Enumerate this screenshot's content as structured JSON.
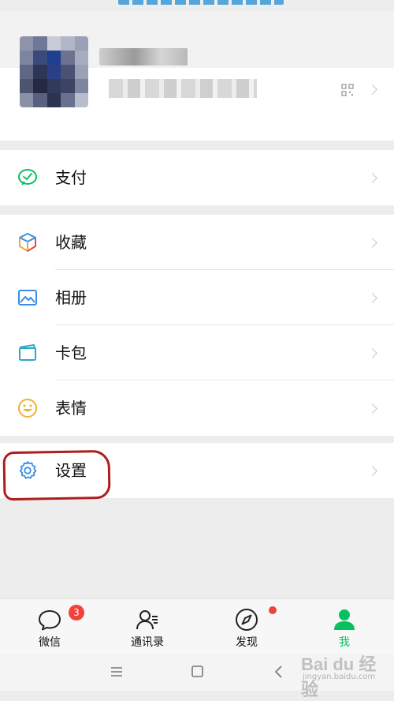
{
  "menu": {
    "pay": {
      "label": "支付",
      "icon": "wechat-pay-icon"
    },
    "favorites": {
      "label": "收藏",
      "icon": "favorites-cube-icon"
    },
    "album": {
      "label": "相册",
      "icon": "album-image-icon"
    },
    "cards": {
      "label": "卡包",
      "icon": "card-wallet-icon"
    },
    "stickers": {
      "label": "表情",
      "icon": "smiley-icon"
    },
    "settings": {
      "label": "设置",
      "icon": "gear-icon"
    }
  },
  "tabbar": {
    "chats": {
      "label": "微信",
      "badge": "3",
      "icon": "chat-bubble-icon"
    },
    "contacts": {
      "label": "通讯录",
      "icon": "contacts-icon"
    },
    "discover": {
      "label": "发现",
      "icon": "compass-icon",
      "has_dot": true
    },
    "me": {
      "label": "我",
      "icon": "person-icon",
      "active": true
    }
  },
  "colors": {
    "accent": "#07c160",
    "highlight_annotation": "#b01c1c",
    "badge": "#f0443a"
  },
  "watermark": {
    "main": "Bai du 经验",
    "sub": "jingyan.baidu.com"
  }
}
